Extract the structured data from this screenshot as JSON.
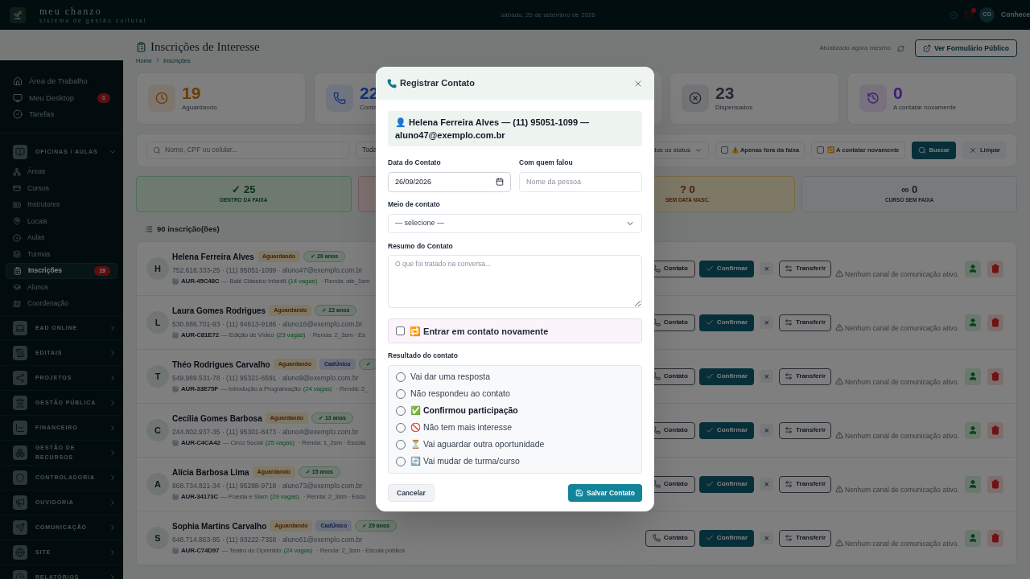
{
  "topbar": {
    "brand": "meu chanzo",
    "tagline": "sistema de gestão cultural",
    "date": "sábado, 26 de setembro de 2026",
    "avatar": "CO",
    "user": "Conhece"
  },
  "sidebar": [
    {
      "kind": "link",
      "label": "Área de Trabalho",
      "selected": false
    },
    {
      "kind": "link",
      "label": "Meu Desktop",
      "badge": "6",
      "selected": false
    },
    {
      "kind": "link",
      "label": "Tarefas",
      "selected": false
    },
    {
      "kind": "section",
      "label": "OFICINAS / AULAS",
      "expanded": true,
      "children": [
        {
          "label": "Áreas",
          "selected": false
        },
        {
          "label": "Cursos",
          "selected": false
        },
        {
          "label": "Instrutores",
          "selected": false
        },
        {
          "label": "Locais",
          "selected": false
        },
        {
          "label": "Aulas",
          "selected": false
        },
        {
          "label": "Turmas",
          "selected": false
        },
        {
          "label": "Inscrições",
          "badge": "19",
          "selected": true
        },
        {
          "label": "Alunos",
          "selected": false
        },
        {
          "label": "Coordenação",
          "selected": false
        }
      ]
    },
    {
      "kind": "section",
      "label": "EAD ONLINE",
      "expanded": false
    },
    {
      "kind": "section",
      "label": "EDITAIS",
      "expanded": false
    },
    {
      "kind": "section",
      "label": "PROJETOS",
      "expanded": false
    },
    {
      "kind": "section",
      "label": "GESTÃO PÚBLICA",
      "expanded": false
    },
    {
      "kind": "section",
      "label": "FINANCEIRO",
      "expanded": false
    },
    {
      "kind": "section",
      "label": "GESTÃO DE RECURSOS",
      "expanded": false
    },
    {
      "kind": "section",
      "label": "CONTROLADORIA",
      "expanded": false
    },
    {
      "kind": "section",
      "label": "OUVIDORIA",
      "expanded": false
    },
    {
      "kind": "section",
      "label": "COMUNICAÇÃO",
      "expanded": false
    },
    {
      "kind": "section",
      "label": "SITE",
      "expanded": false
    },
    {
      "kind": "section",
      "label": "RELATÓRIOS",
      "expanded": false
    }
  ],
  "header": {
    "title": "Inscrições de Interesse",
    "breadcrumb": [
      "Home",
      "Inscrições"
    ],
    "updated": "Atualizado agora mesmo",
    "public_button": "Ver Formulário Público"
  },
  "stats": [
    {
      "value": "19",
      "label": "Aguardando"
    },
    {
      "value": "22",
      "label": "Conta"
    },
    {
      "value": "23",
      "label": "Dispensados"
    },
    {
      "value": "0",
      "label": "A contatar novamente"
    }
  ],
  "filters": {
    "search_placeholder": "Nome, CPF ou celular...",
    "select_1": "Toda",
    "select_2": "dos os status",
    "checks": [
      {
        "label": "⚠️ Apenas fora da faixa",
        "checked": false
      },
      {
        "label": "🔁 A contatar novamente",
        "checked": false
      }
    ],
    "search_button": "Buscar",
    "clear_button": "Limpar"
  },
  "ranges": [
    {
      "kind": "inside",
      "value": "✓ 25",
      "label": "DENTRO DA FAIXA"
    },
    {
      "kind": "outside"
    },
    {
      "kind": "unknown",
      "value": "? 0",
      "label": "SEM DATA NASC."
    },
    {
      "kind": "none",
      "value": "∞ 0",
      "label": "CURSO SEM FAIXA"
    }
  ],
  "list": {
    "count": "90 inscrição(ões)",
    "rows": [
      {
        "initial": "H",
        "name": "Helena Ferreira Alves",
        "status": "Aguardando",
        "tags": [],
        "age": "✓ 20 anos",
        "meta": "752.618.333-25 · (11) 95051-1099 · aluno47@exemplo.com.br",
        "code": "AUR-45C48C",
        "course": "— Balé Clássico Infantil",
        "vacancies": "(14 vagas)",
        "rest": "· Renda: ate_1sm",
        "actions": {
          "contact": "Contato",
          "confirm": "Confirmar",
          "dismiss": "×",
          "transfer": "Transferir"
        },
        "note": "Nenhum canal de comunicação ativo."
      },
      {
        "initial": "L",
        "name": "Laura Gomes Rodrigues",
        "status": "Aguardando",
        "tags": [],
        "age": "✓ 22 anos",
        "meta": "530.886.701-93 · (11) 94613-9186 · aluno16@exemplo.com.br",
        "code": "AUR-C81E72",
        "course": "— Edição de Vídeo",
        "vacancies": "(23 vagas)",
        "rest": "· Renda: 2_3sm · Es",
        "actions": {
          "contact": "Contato",
          "confirm": "Confirmar",
          "dismiss": "×",
          "transfer": "Transferir"
        },
        "note": "Nenhum canal de comunicação ativo."
      },
      {
        "initial": "T",
        "name": "Théo Rodrigues Carvalho",
        "status": "Aguardando",
        "tags": [
          "CadÚnico"
        ],
        "age": "✓",
        "meta": "549.989.531-78 · (11) 95321-6591 · aluno9@exemplo.com.br",
        "code": "AUR-33E75F",
        "course": "— Introdução à Programação",
        "vacancies": "(24 vagas)",
        "rest": "· Renda: 2_",
        "actions": {
          "contact": "Contato",
          "confirm": "Confirmar",
          "dismiss": "×",
          "transfer": "Transferir"
        },
        "note": "Nenhum canal de comunicação ativo."
      },
      {
        "initial": "C",
        "name": "Cecília Gomes Barbosa",
        "status": "Aguardando",
        "tags": [],
        "age": "✓ 13 anos",
        "meta": "244.802.937-35 · (11) 95301-8473 · aluno4@exemplo.com.br",
        "code": "AUR-C4CA42",
        "course": "— Circo Social",
        "vacancies": "(25 vagas)",
        "rest": "· Renda: 1_2sm · Escola",
        "actions": {
          "contact": "Contato",
          "confirm": "Confirmar",
          "dismiss": "×",
          "transfer": "Transferir"
        },
        "note": "Nenhum canal de comunicação ativo."
      },
      {
        "initial": "A",
        "name": "Alícia Barbosa Lima",
        "status": "Aguardando",
        "tags": [],
        "age": "✓ 15 anos",
        "meta": "868.734.821-34 · (11) 95288-9718 · aluno73@exemplo.com.br",
        "code": "AUR-34173C",
        "course": "— Poesia e Slam",
        "vacancies": "(29 vagas)",
        "rest": "· Renda: 2_3sm · Esco",
        "actions": {
          "contact": "Contato",
          "confirm": "Confirmar",
          "dismiss": "×",
          "transfer": "Transferir"
        },
        "note": "Nenhum canal de comunicação ativo."
      },
      {
        "initial": "S",
        "name": "Sophia Martins Carvalho",
        "status": "Aguardando",
        "tags": [
          "CadÚnico"
        ],
        "age": "✓ 29 anos",
        "meta": "648.714.863-95 · (11) 93222-7358 · aluno61@exemplo.com.br",
        "code": "AUR-C74D97",
        "course": "— Teatro do Oprimido",
        "vacancies": "(24 vagas)",
        "rest": "· Renda: 2_3sm · Escola pública",
        "actions": {
          "contact": "Contato",
          "confirm": "Confirmar",
          "dismiss": "×",
          "transfer": "Transferir"
        },
        "note": "Nenhum canal de comunicação ativo."
      }
    ]
  },
  "modal": {
    "title": "Registrar Contato",
    "person": "👤 Helena Ferreira Alves — (11) 95051-1099 — aluno47@exemplo.com.br",
    "date_label": "Data do Contato",
    "date_value": "26/09/2026",
    "who_label": "Com quem falou",
    "who_placeholder": "Nome da pessoa",
    "means_label": "Meio de contato",
    "means_value": "— selecione —",
    "summary_label": "Resumo do Contato",
    "summary_placeholder": "O que foi tratado na conversa...",
    "retry": {
      "label": "🔁 Entrar em contato novamente",
      "checked": false
    },
    "result_label": "Resultado do contato",
    "options": [
      {
        "label": "Vai dar uma resposta",
        "bold": false,
        "selected": false
      },
      {
        "label": "Não respondeu ao contato",
        "bold": false,
        "selected": false
      },
      {
        "label": "✅ Confirmou participação",
        "bold": true,
        "selected": false
      },
      {
        "label": "🚫 Não tem mais interesse",
        "bold": false,
        "selected": false
      },
      {
        "label": "⏳ Vai aguardar outra oportunidade",
        "bold": false,
        "selected": false
      },
      {
        "label": "🔄 Vai mudar de turma/curso",
        "bold": false,
        "selected": false
      }
    ],
    "cancel": "Cancelar",
    "save": "Salvar Contato"
  }
}
